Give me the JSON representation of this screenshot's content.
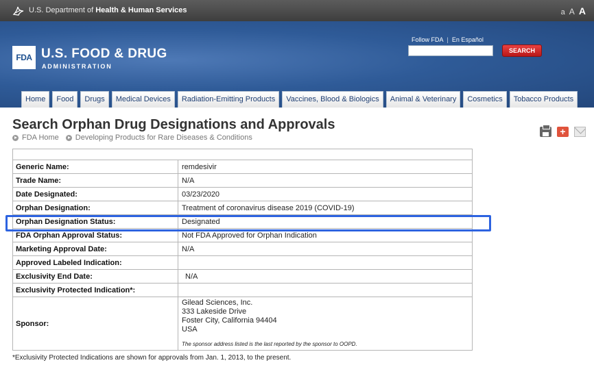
{
  "hhs_bar": {
    "prefix": "U.S. Department of",
    "dept": "Health & Human Services",
    "text_small": "a",
    "text_medium": "A",
    "text_large": "A"
  },
  "header": {
    "logo_text": "FDA",
    "title": "U.S. FOOD & DRUG",
    "subtitle": "ADMINISTRATION",
    "follow_link": "Follow FDA",
    "spanish_link": "En Español",
    "separator": "|",
    "search_value": "",
    "search_button": "SEARCH"
  },
  "nav": {
    "tabs": [
      {
        "label": "Home"
      },
      {
        "label": "Food"
      },
      {
        "label": "Drugs"
      },
      {
        "label": "Medical Devices"
      },
      {
        "label": "Radiation-Emitting Products"
      },
      {
        "label": "Vaccines, Blood & Biologics"
      },
      {
        "label": "Animal & Veterinary"
      },
      {
        "label": "Cosmetics"
      },
      {
        "label": "Tobacco Products"
      }
    ]
  },
  "page": {
    "title": "Search Orphan Drug Designations and Approvals",
    "breadcrumb": [
      "FDA Home",
      "Developing Products for Rare Diseases & Conditions"
    ]
  },
  "tools": {
    "print": "print-icon",
    "add": "plus-icon",
    "email": "email-icon"
  },
  "record": {
    "rows": [
      {
        "label": "Generic Name:",
        "value": "remdesivir"
      },
      {
        "label": "Trade Name:",
        "value": "N/A"
      },
      {
        "label": "Date Designated:",
        "value": "03/23/2020"
      },
      {
        "label": "Orphan Designation:",
        "value": "Treatment of coronavirus disease 2019 (COVID-19)"
      },
      {
        "label": "Orphan Designation Status:",
        "value": "Designated"
      },
      {
        "label": "FDA Orphan Approval Status:",
        "value": "Not FDA Approved for Orphan Indication"
      },
      {
        "label": "Marketing Approval Date:",
        "value": "N/A"
      },
      {
        "label": "Approved Labeled Indication:",
        "value": ""
      },
      {
        "label": "Exclusivity End Date:",
        "value": "N/A"
      },
      {
        "label": "Exclusivity Protected Indication*:",
        "value": ""
      }
    ],
    "sponsor": {
      "label": "Sponsor:",
      "name": "Gilead Sciences, Inc.",
      "street": "333 Lakeside Drive",
      "city": "Foster City, California 94404",
      "country": "USA",
      "note": "The sponsor address listed is the last reported by the sponsor to OOPD."
    }
  },
  "footnote": "*Exclusivity Protected Indications are shown for approvals from Jan. 1, 2013, to the present.",
  "colors": {
    "highlight": "#2d63e0",
    "header_blue": "#2f5b98",
    "search_red": "#d42a2a"
  }
}
